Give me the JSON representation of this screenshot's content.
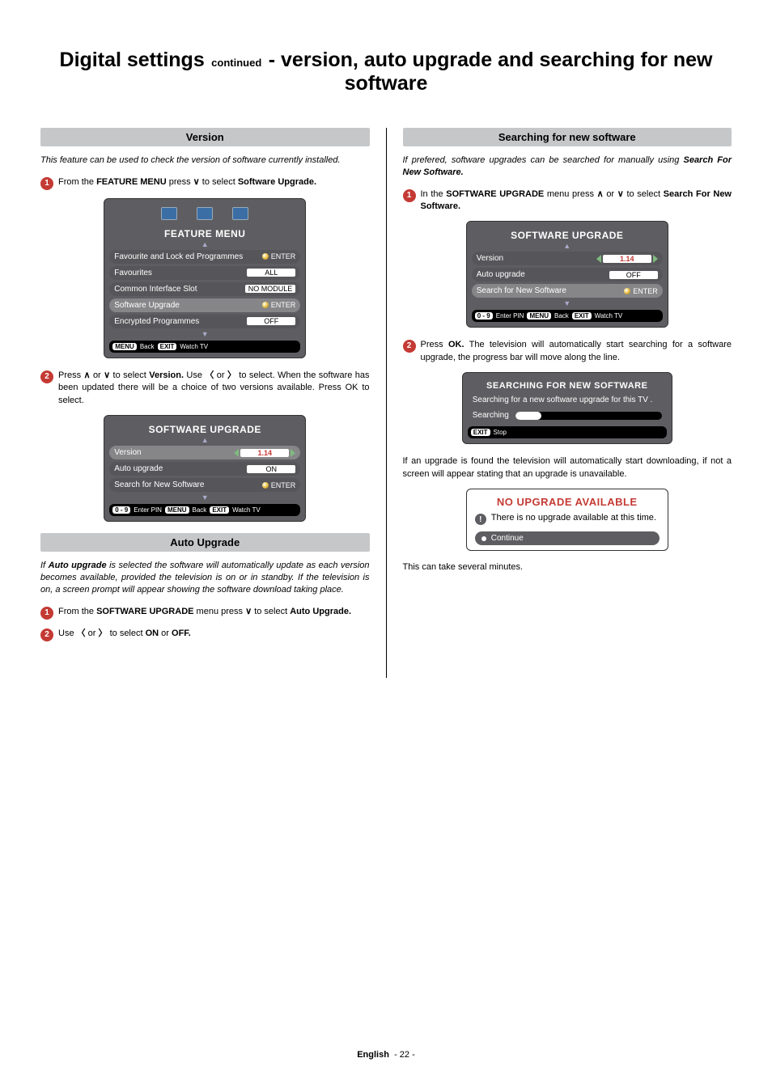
{
  "title": {
    "part1": "Digital settings",
    "continued": "continued",
    "part2": "- version, auto upgrade and searching for new software"
  },
  "left": {
    "version_header": "Version",
    "version_intro": "This feature can be used to check the version of software currently installed.",
    "version_step1_a": "From the ",
    "version_step1_b": "FEATURE MENU",
    "version_step1_c": " press ",
    "version_step1_d": " to select ",
    "version_step1_e": "Software Upgrade.",
    "feature_menu_title": "FEATURE MENU",
    "fm_rows": {
      "r0_label": "Favourite and Lock ed Programmes",
      "r0_val": "ENTER",
      "r1_label": "Favourites",
      "r1_val": "ALL",
      "r2_label": "Common Interface Slot",
      "r2_val": "NO MODULE",
      "r3_label": "Software Upgrade",
      "r3_val": "ENTER",
      "r4_label": "Encrypted Programmes",
      "r4_val": "OFF"
    },
    "fm_footer": {
      "menu": "MENU",
      "back": "Back",
      "exit": "EXIT",
      "watch": "Watch TV"
    },
    "version_step2": "Press  ∧  or  ∨  to select Version. Use  〈  or  〉  to select. When the software has been updated there will be a choice of two versions available. Press OK to select.",
    "version_step2_pre": "Press ",
    "version_step2_mid1": " or ",
    "version_step2_mid2": " to select ",
    "version_step2_b1": "Version.",
    "version_step2_mid3": " Use ",
    "version_step2_mid4": " or ",
    "version_step2_mid5": " to select. When the software has been updated there will be a choice of two versions available. Press OK to select.",
    "su_panel": {
      "title": "SOFTWARE UPGRADE",
      "rows": {
        "version_label": "Version",
        "version_val": "1.14",
        "auto_label": "Auto upgrade",
        "auto_val": "ON",
        "search_label": "Search for New Software",
        "search_val": "ENTER"
      },
      "footer": {
        "pin_key": "0 - 9",
        "pin_txt": "Enter PIN",
        "menu": "MENU",
        "back": "Back",
        "exit": "EXIT",
        "watch": "Watch TV"
      }
    },
    "auto_header": "Auto Upgrade",
    "auto_intro": "If Auto upgrade is selected the software will automatically update as each version becomes available, provided the television is on or in standby. If the television is on, a screen prompt will appear showing the software download taking place.",
    "auto_intro_b": "Auto upgrade",
    "auto_step1_a": "From the ",
    "auto_step1_b": "SOFTWARE UPGRADE",
    "auto_step1_c": " menu press ",
    "auto_step1_d": " to select ",
    "auto_step1_e": "Auto Upgrade.",
    "auto_step2_a": "Use ",
    "auto_step2_b": " or ",
    "auto_step2_c": " to select ",
    "auto_step2_d": "ON",
    "auto_step2_e": " or ",
    "auto_step2_f": "OFF."
  },
  "right": {
    "search_header": "Searching for new software",
    "search_intro_a": "If prefered, software upgrades can be searched for manually using ",
    "search_intro_b": "Search For New Software.",
    "search_step1_a": "In the ",
    "search_step1_b": "SOFTWARE UPGRADE",
    "search_step1_c": " menu press ",
    "search_step1_d": " or ",
    "search_step1_e": " to select ",
    "search_step1_f": "Search For New Software.",
    "su_panel": {
      "title": "SOFTWARE UPGRADE",
      "rows": {
        "version_label": "Version",
        "version_val": "1.14",
        "auto_label": "Auto upgrade",
        "auto_val": "OFF",
        "search_label": "Search for New Software",
        "search_val": "ENTER"
      },
      "footer": {
        "pin_key": "0 - 9",
        "pin_txt": "Enter PIN",
        "menu": "MENU",
        "back": "Back",
        "exit": "EXIT",
        "watch": "Watch TV"
      }
    },
    "search_step2_a": "Press ",
    "search_step2_b": "OK.",
    "search_step2_c": " The television will automatically start searching for a software upgrade, the progress bar will move along the line.",
    "searching_panel": {
      "title": "SEARCHING FOR NEW SOFTWARE",
      "line1": "Searching for a new software upgrade for this TV .",
      "label": "Searching",
      "footer_exit": "EXIT",
      "footer_stop": "Stop"
    },
    "result_text": "If an upgrade is found the television will automatically start downloading, if not a screen  will appear stating that an upgrade is unavailable.",
    "no_upgrade": {
      "title": "NO UPGRADE AVAILABLE",
      "body": "There is no upgrade available at this time.",
      "continue": "Continue"
    },
    "tail": "This can take several minutes."
  },
  "footer": {
    "lang": "English",
    "page": "- 22 -"
  }
}
